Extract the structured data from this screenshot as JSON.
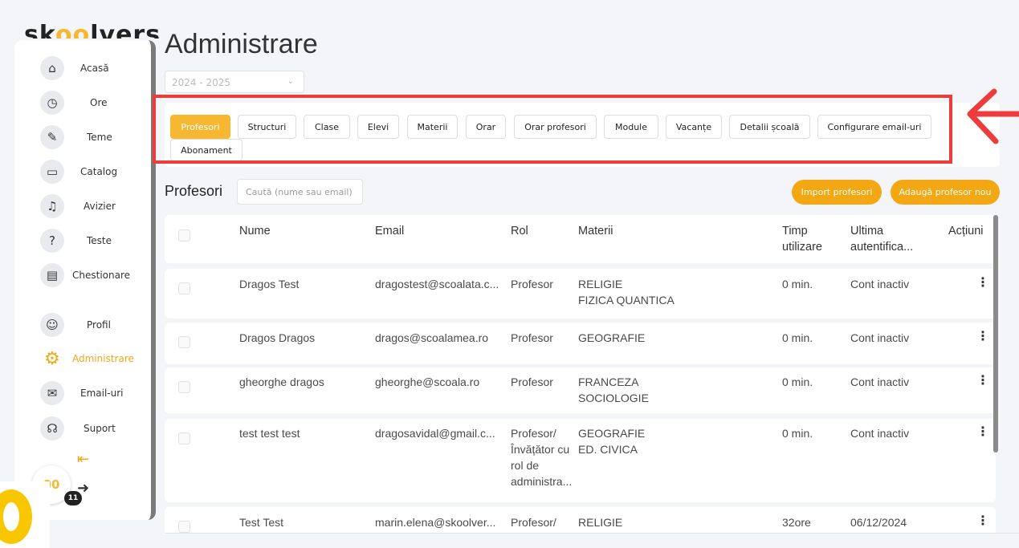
{
  "app": {
    "logo": "skoolvers"
  },
  "sidebar": {
    "items": [
      {
        "label": "Acasă",
        "icon": "home-icon",
        "glyph": "⌂"
      },
      {
        "label": "Ore",
        "icon": "clock-icon",
        "glyph": "◷"
      },
      {
        "label": "Teme",
        "icon": "pencil-icon",
        "glyph": "✎"
      },
      {
        "label": "Catalog",
        "icon": "book-icon",
        "glyph": "▭"
      },
      {
        "label": "Avizier",
        "icon": "bell-icon",
        "glyph": "♫"
      },
      {
        "label": "Teste",
        "icon": "question-icon",
        "glyph": "?"
      },
      {
        "label": "Chestionare",
        "icon": "document-icon",
        "glyph": "▤"
      },
      {
        "label": "Profil",
        "icon": "profile-icon",
        "glyph": "☺"
      },
      {
        "label": "Administrare",
        "icon": "gears-icon",
        "glyph": "⚙"
      },
      {
        "label": "Email-uri",
        "icon": "envelope-icon",
        "glyph": "✉"
      },
      {
        "label": "Suport",
        "icon": "headset-icon",
        "glyph": "☊"
      }
    ],
    "active_index": 8,
    "counter": "00",
    "counter_badge": "11"
  },
  "page": {
    "title": "Administrare",
    "year": "2024 - 2025"
  },
  "tabs": [
    {
      "label": "Profesori"
    },
    {
      "label": "Structuri"
    },
    {
      "label": "Clase"
    },
    {
      "label": "Elevi"
    },
    {
      "label": "Materii"
    },
    {
      "label": "Orar"
    },
    {
      "label": "Orar profesori"
    },
    {
      "label": "Module"
    },
    {
      "label": "Vacanțe"
    },
    {
      "label": "Detalii școală"
    },
    {
      "label": "Configurare email-uri"
    },
    {
      "label": "Abonament"
    }
  ],
  "section": {
    "title": "Profesori",
    "search_placeholder": "Caută (nume sau email)",
    "import_label": "Import profesori",
    "add_label": "Adaugă profesor nou"
  },
  "table": {
    "headers": {
      "nume": "Nume",
      "email": "Email",
      "rol": "Rol",
      "materii": "Materii",
      "timp": "Timp\nutilizare",
      "ultima": "Ultima\nautentifica...",
      "actiuni": "Acțiuni"
    },
    "rows": [
      {
        "nume": "Dragos Test",
        "email": "dragostest@scoalata.c...",
        "rol": "Profesor",
        "materii": "RELIGIE\nFIZICA QUANTICA",
        "timp": "0 min.",
        "ultima": "Cont inactiv"
      },
      {
        "nume": "Dragos Dragos",
        "email": "dragos@scoalamea.ro",
        "rol": "Profesor",
        "materii": "GEOGRAFIE",
        "timp": "0 min.",
        "ultima": "Cont inactiv"
      },
      {
        "nume": "gheorghe dragos",
        "email": "gheorghe@scoala.ro",
        "rol": "Profesor",
        "materii": "FRANCEZA\nSOCIOLOGIE",
        "timp": "0 min.",
        "ultima": "Cont inactiv"
      },
      {
        "nume": "test test test",
        "email": "dragosavidal@gmail.c...",
        "rol": "Profesor/\nÎnvățător cu\nrol de\nadministra...",
        "materii": "GEOGRAFIE\nED. CIVICA",
        "timp": "0 min.",
        "ultima": "Cont inactiv"
      },
      {
        "nume": "Test Test",
        "email": "marin.elena@skoolver...",
        "rol": "Profesor/",
        "materii": "RELIGIE",
        "timp": "32ore",
        "ultima": "06/12/2024"
      }
    ]
  },
  "colors": {
    "accent": "#f3a712",
    "highlight": "#ee3b3b"
  }
}
